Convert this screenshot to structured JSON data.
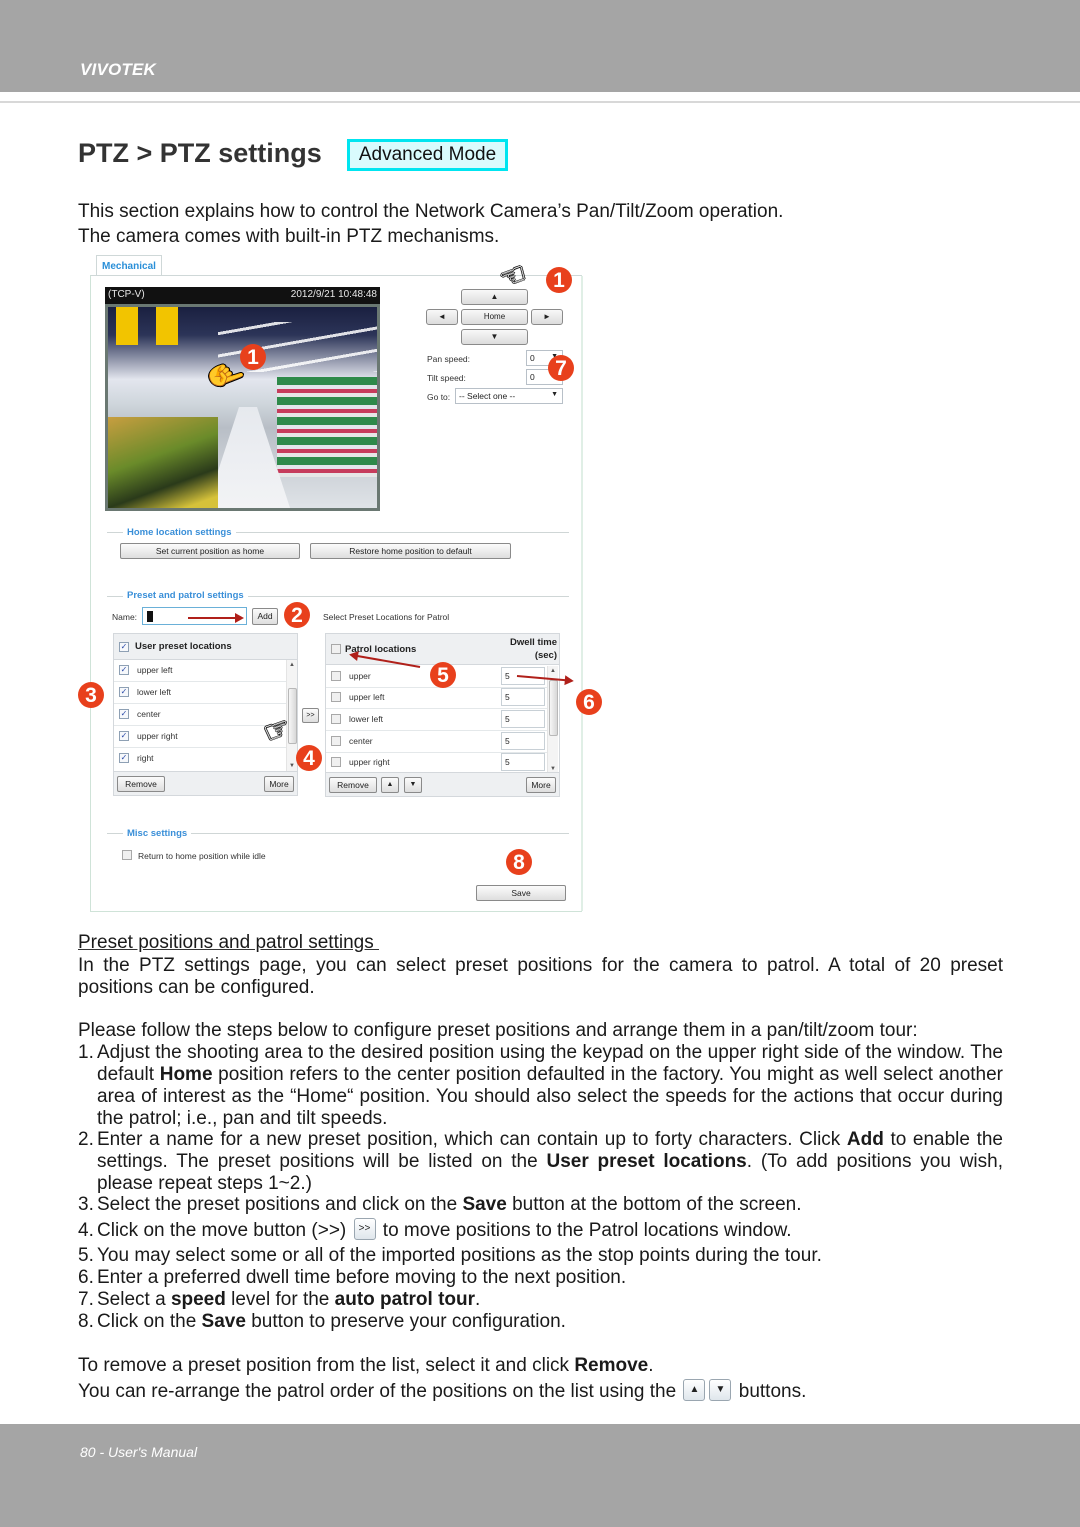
{
  "header": {
    "brand": "VIVOTEK"
  },
  "title": {
    "text": "PTZ > PTZ settings",
    "badge": "Advanced Mode"
  },
  "intro": [
    "This section explains how to control the Network Camera’s Pan/Tilt/Zoom operation.",
    "The camera comes with built-in PTZ mechanisms."
  ],
  "screenshot": {
    "tab": "Mechanical",
    "camera": {
      "protocol": "(TCP-V)",
      "timestamp": "2012/9/21 10:48:48"
    },
    "ptz_pad": {
      "up": "▲",
      "left": "◄",
      "home": "Home",
      "right": "►",
      "down": "▼"
    },
    "pan_speed": {
      "label": "Pan speed:",
      "value": "0"
    },
    "tilt_speed": {
      "label": "Tilt speed:",
      "value": "0"
    },
    "goto": {
      "label": "Go to:",
      "value": "-- Select one --"
    },
    "home_section": {
      "title": "Home location settings",
      "set_button": "Set current position as home",
      "restore_button": "Restore home position to default"
    },
    "preset_section": {
      "title": "Preset and patrol settings",
      "name_label": "Name:",
      "name_value": "",
      "add_button": "Add",
      "patrol_caption": "Select Preset Locations for Patrol"
    },
    "user_presets": {
      "header": "User preset locations",
      "header_checked": true,
      "items": [
        {
          "label": "upper left",
          "checked": true
        },
        {
          "label": "lower left",
          "checked": true
        },
        {
          "label": "center",
          "checked": true
        },
        {
          "label": "upper right",
          "checked": true
        },
        {
          "label": "right",
          "checked": true
        }
      ],
      "remove_button": "Remove",
      "more_button": "More",
      "move_button": ">>"
    },
    "patrol_locations": {
      "header": "Patrol locations",
      "dwell_header_line1": "Dwell time",
      "dwell_header_line2": "(sec)",
      "items": [
        {
          "label": "upper",
          "dwell": "5",
          "checked": false
        },
        {
          "label": "upper left",
          "dwell": "5",
          "checked": false
        },
        {
          "label": "lower left",
          "dwell": "5",
          "checked": false
        },
        {
          "label": "center",
          "dwell": "5",
          "checked": false
        },
        {
          "label": "upper right",
          "dwell": "5",
          "checked": false
        }
      ],
      "remove_button": "Remove",
      "up_button": "▲",
      "down_button": "▼",
      "more_button": "More"
    },
    "misc_section": {
      "title": "Misc settings",
      "return_home_label": "Return to home position while idle",
      "return_home_checked": false
    },
    "save_button": "Save",
    "callouts": [
      "1",
      "1",
      "2",
      "3",
      "4",
      "5",
      "6",
      "7",
      "8"
    ]
  },
  "section_heading": "Preset positions and patrol settings ",
  "para1": "In the PTZ settings page, you can select preset positions for the camera to patrol. A total of 20 preset positions can be configured.",
  "para2": "Please follow the steps below to configure preset positions and arrange them in a pan/tilt/zoom tour:",
  "steps": [
    {
      "num": "1.",
      "parts": [
        "Adjust the shooting area to the desired position using the keypad on the upper right side of the window. The default ",
        "Home",
        " position refers to the center position defaulted in the factory. You might as well select another area of interest as the “Home“ position. You should also select the speeds for the actions that occur during the patrol; i.e., pan and tilt speeds."
      ]
    },
    {
      "num": "2.",
      "parts": [
        "Enter a name for a new preset position, which can contain up to forty characters. Click ",
        "Add",
        " to enable the settings. The preset positions will be listed on the ",
        "User preset locations",
        ". (To add positions you wish, please repeat steps 1~2.)"
      ]
    },
    {
      "num": "3.",
      "parts": [
        "Select the preset positions and click on the ",
        "Save",
        " button at the bottom of the screen."
      ]
    },
    {
      "num": "4.",
      "parts": [
        "Click on the move button (>>) ",
        ">>",
        " to move positions to the Patrol locations window."
      ]
    },
    {
      "num": "5.",
      "parts": [
        "You may select some or all of the imported positions as the stop points during the tour."
      ]
    },
    {
      "num": "6.",
      "parts": [
        "Enter a preferred dwell time before moving to the next position."
      ]
    },
    {
      "num": "7.",
      "parts": [
        "Select a ",
        "speed",
        " level for the ",
        "auto patrol tour",
        "."
      ]
    },
    {
      "num": "8.",
      "parts": [
        "Click on the ",
        "Save",
        " button to preserve your configuration."
      ]
    }
  ],
  "remove_note": {
    "before": "To remove a preset position from the list, select it and click ",
    "bold": "Remove",
    "after": "."
  },
  "rearrange_note": {
    "before": "You can re-arrange the patrol order of the positions on the list using the ",
    "up": "▲",
    "down": "▼",
    "after": " buttons."
  },
  "footer": {
    "text": "80 - User's Manual"
  },
  "colors": {
    "header_gray": "#a5a5a5",
    "badge_cyan": "#00e5f0",
    "callout_red": "#e8401c",
    "section_blue": "#3a8fd8"
  }
}
